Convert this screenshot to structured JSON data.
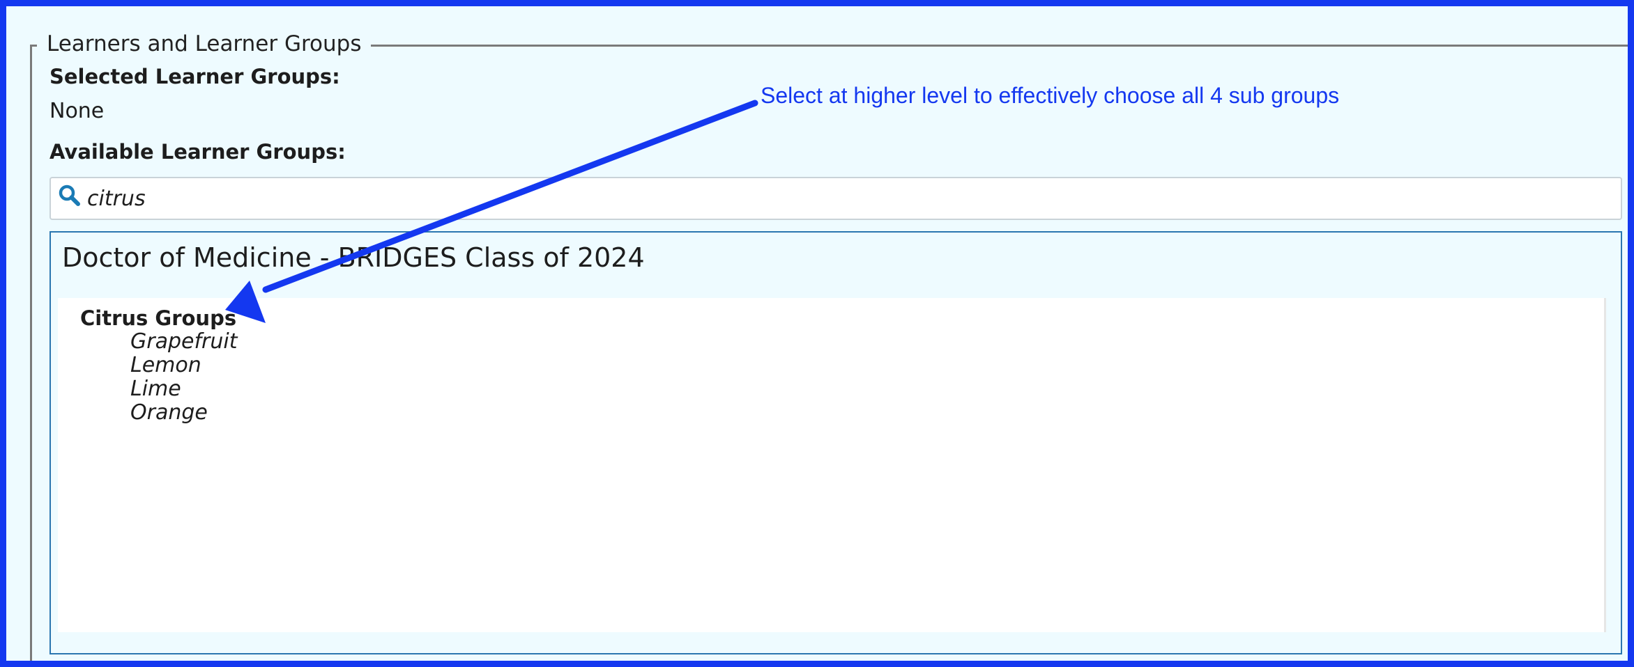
{
  "fieldset": {
    "legend": "Learners and Learner Groups",
    "selected_label": "Selected Learner Groups:",
    "selected_value": "None",
    "available_label": "Available Learner Groups:"
  },
  "search": {
    "value": "citrus",
    "icon": "search-icon"
  },
  "program": {
    "title": "Doctor of Medicine - BRIDGES Class of 2024",
    "parent_group": "Citrus Groups",
    "sub_groups": [
      "Grapefruit",
      "Lemon",
      "Lime",
      "Orange"
    ]
  },
  "annotation": {
    "text": "Select at higher level to effectively choose all 4 sub groups",
    "color": "#1438f0"
  },
  "colors": {
    "frame_border": "#1438f0",
    "background": "#eefbff",
    "program_border": "#2a76b0",
    "search_icon": "#1a7bb5"
  }
}
